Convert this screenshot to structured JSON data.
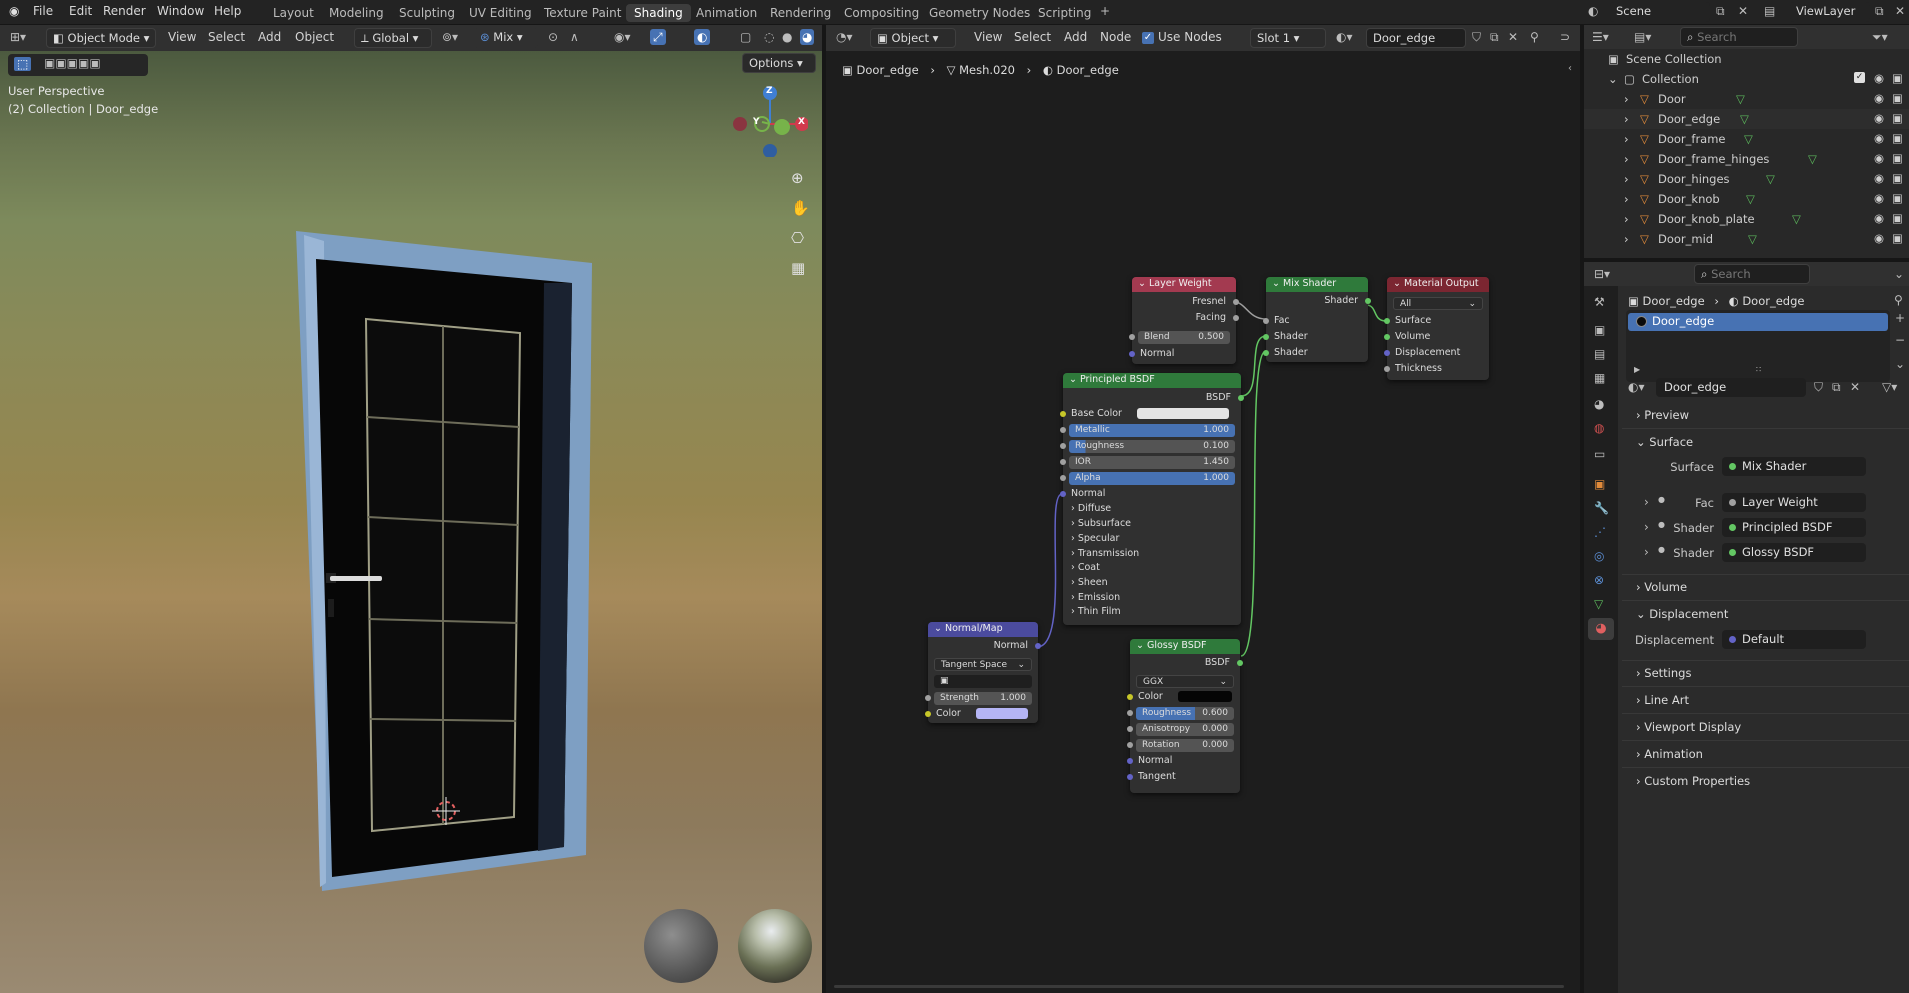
{
  "menus": [
    "File",
    "Edit",
    "Render",
    "Window",
    "Help"
  ],
  "workspaces": [
    "Layout",
    "Modeling",
    "Sculpting",
    "UV Editing",
    "Texture Paint",
    "Shading",
    "Animation",
    "Rendering",
    "Compositing",
    "Geometry Nodes",
    "Scripting"
  ],
  "active_workspace": "Shading",
  "scene": {
    "name": "Scene",
    "view_layer": "ViewLayer"
  },
  "viewport": {
    "mode": "Object Mode",
    "menus": [
      "View",
      "Select",
      "Add",
      "Object"
    ],
    "orientation": "Global",
    "snap_mode": "Mix",
    "options": "Options",
    "overlay_text_1": "User Perspective",
    "overlay_text_2": "(2) Collection | Door_edge",
    "gizmo": {
      "z": "Z",
      "y": "Y",
      "x": "X"
    }
  },
  "node_editor": {
    "type": "Object",
    "menus": [
      "View",
      "Select",
      "Add",
      "Node"
    ],
    "use_nodes": "Use Nodes",
    "slot": "Slot 1",
    "material": "Door_edge",
    "breadcrumb": [
      "Door_edge",
      "Mesh.020",
      "Door_edge"
    ],
    "nodes": {
      "layer_weight": {
        "title": "Layer Weight",
        "outputs": [
          "Fresnel",
          "Facing"
        ],
        "blend_label": "Blend",
        "blend": "0.500",
        "normal": "Normal"
      },
      "mix_shader": {
        "title": "Mix Shader",
        "output": "Shader",
        "inputs": [
          "Fac",
          "Shader",
          "Shader"
        ]
      },
      "material_output": {
        "title": "Material Output",
        "target": "All",
        "inputs": [
          "Surface",
          "Volume",
          "Displacement",
          "Thickness"
        ]
      },
      "principled": {
        "title": "Principled BSDF",
        "output": "BSDF",
        "base_color": "Base Color",
        "fields": [
          {
            "label": "Metallic",
            "value": "1.000"
          },
          {
            "label": "Roughness",
            "value": "0.100"
          },
          {
            "label": "IOR",
            "value": "1.450"
          },
          {
            "label": "Alpha",
            "value": "1.000"
          }
        ],
        "normal": "Normal",
        "panels": [
          "Diffuse",
          "Subsurface",
          "Specular",
          "Transmission",
          "Coat",
          "Sheen",
          "Emission",
          "Thin Film"
        ]
      },
      "normal_map": {
        "title": "Normal/Map",
        "output": "Normal",
        "space": "Tangent Space",
        "strength_label": "Strength",
        "strength": "1.000",
        "color": "Color"
      },
      "glossy": {
        "title": "Glossy BSDF",
        "output": "BSDF",
        "distribution": "GGX",
        "color": "Color",
        "fields": [
          {
            "label": "Roughness",
            "value": "0.600"
          },
          {
            "label": "Anisotropy",
            "value": "0.000"
          },
          {
            "label": "Rotation",
            "value": "0.000"
          }
        ],
        "inputs": [
          "Normal",
          "Tangent"
        ]
      }
    }
  },
  "outliner": {
    "search_placeholder": "Search",
    "root": "Scene Collection",
    "collection": "Collection",
    "items": [
      "Door",
      "Door_edge",
      "Door_frame",
      "Door_frame_hinges",
      "Door_hinges",
      "Door_knob",
      "Door_knob_plate",
      "Door_mid"
    ]
  },
  "properties": {
    "search_placeholder": "Search",
    "object": "Door_edge",
    "material": "Door_edge",
    "slot_item": "Door_edge",
    "material_field": "Door_edge",
    "sections": {
      "preview": "Preview",
      "surface": "Surface",
      "volume": "Volume",
      "displacement": "Displacement",
      "settings": "Settings",
      "line_art": "Line Art",
      "viewport_display": "Viewport Display",
      "animation": "Animation",
      "custom_properties": "Custom Properties"
    },
    "surface_label": "Surface",
    "surface_value": "Mix Shader",
    "fac_label": "Fac",
    "fac_value": "Layer Weight",
    "shader1_label": "Shader",
    "shader1_value": "Principled BSDF",
    "shader2_label": "Shader",
    "shader2_value": "Glossy BSDF",
    "disp_label": "Displacement",
    "disp_value": "Default"
  },
  "colors": {
    "accent": "#4772b3",
    "selected": "#4772b3",
    "shader_socket": "#63c763",
    "vector_socket": "#6363c7",
    "color_socket": "#c7c729"
  }
}
